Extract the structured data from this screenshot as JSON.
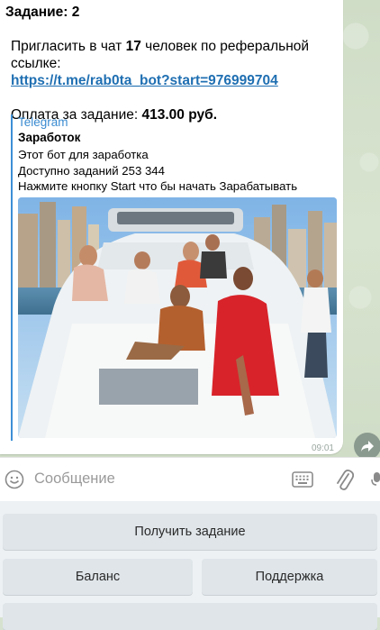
{
  "message": {
    "task_label": "Задание:",
    "task_number": "2",
    "invite_prefix": "Пригласить в чат",
    "invite_count": "17",
    "invite_suffix": "человек по реферальной",
    "invite_line2": "ссылке:",
    "link_url": "https://t.me/rab0ta_bot?start=976999704",
    "payment_label": "Оплата за задание:",
    "payment_amount": "413.00 руб.",
    "time": "09:01"
  },
  "preview": {
    "site_name": "Telegram",
    "title": "Заработок",
    "desc_lines": [
      "Этот бот для заработка",
      "Доступно заданий 253 344",
      "Нажмите кнопку Start что бы начать Зарабатывать"
    ]
  },
  "input": {
    "placeholder": "Сообщение"
  },
  "keyboard": {
    "get_task": "Получить задание",
    "balance": "Баланс",
    "support": "Поддержка"
  },
  "colors": {
    "link": "#1f6fb2",
    "preview_accent": "#3d8fd6",
    "keyboard_button": "#dfe5e9"
  }
}
